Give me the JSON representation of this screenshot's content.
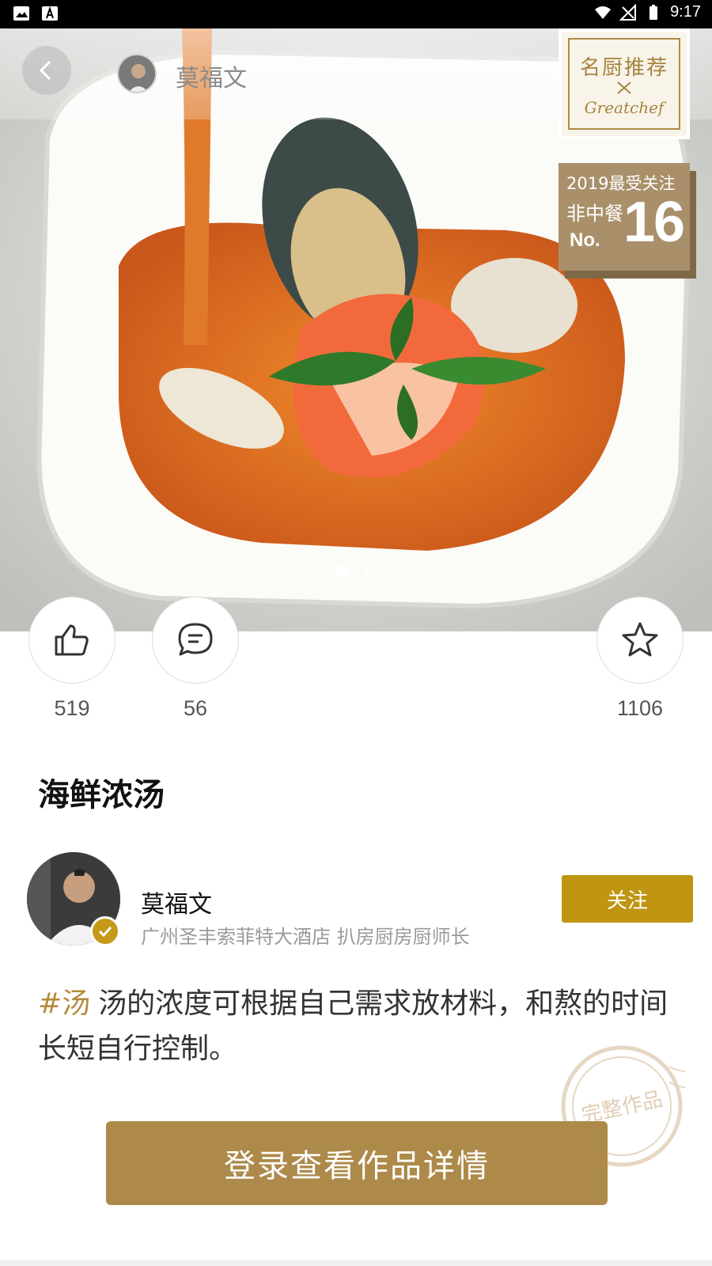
{
  "status_bar": {
    "time": "9:17"
  },
  "header": {
    "chef_name": "莫福文",
    "icons": [
      "back-arrow-icon",
      "share-icon",
      "more-icon"
    ]
  },
  "brand_badge": {
    "title": "名厨推荐",
    "subtitle": "Greatchef"
  },
  "rank_badge": {
    "line1": "2019最受关注",
    "line2": "非中餐",
    "line3": "No.",
    "number": "16"
  },
  "carousel": {
    "count": 2,
    "active_index": 0
  },
  "actions": {
    "likes": "519",
    "comments": "56",
    "favorites": "1106"
  },
  "recipe": {
    "title": "海鲜浓汤"
  },
  "author": {
    "name": "莫福文",
    "title": "广州圣丰索菲特大酒店 扒房厨房厨师长",
    "follow_label": "关注"
  },
  "description": {
    "tag": "#汤",
    "text": "汤的浓度可根据自己需求放材料，和熬的时间长短自行控制。"
  },
  "stamp": {
    "text": "完整作品"
  },
  "login_button": {
    "label": "登录查看作品详情"
  },
  "colors": {
    "gold": "#c09511",
    "login_brown": "#ad8a4a",
    "tag_gold": "#b58a3b"
  }
}
